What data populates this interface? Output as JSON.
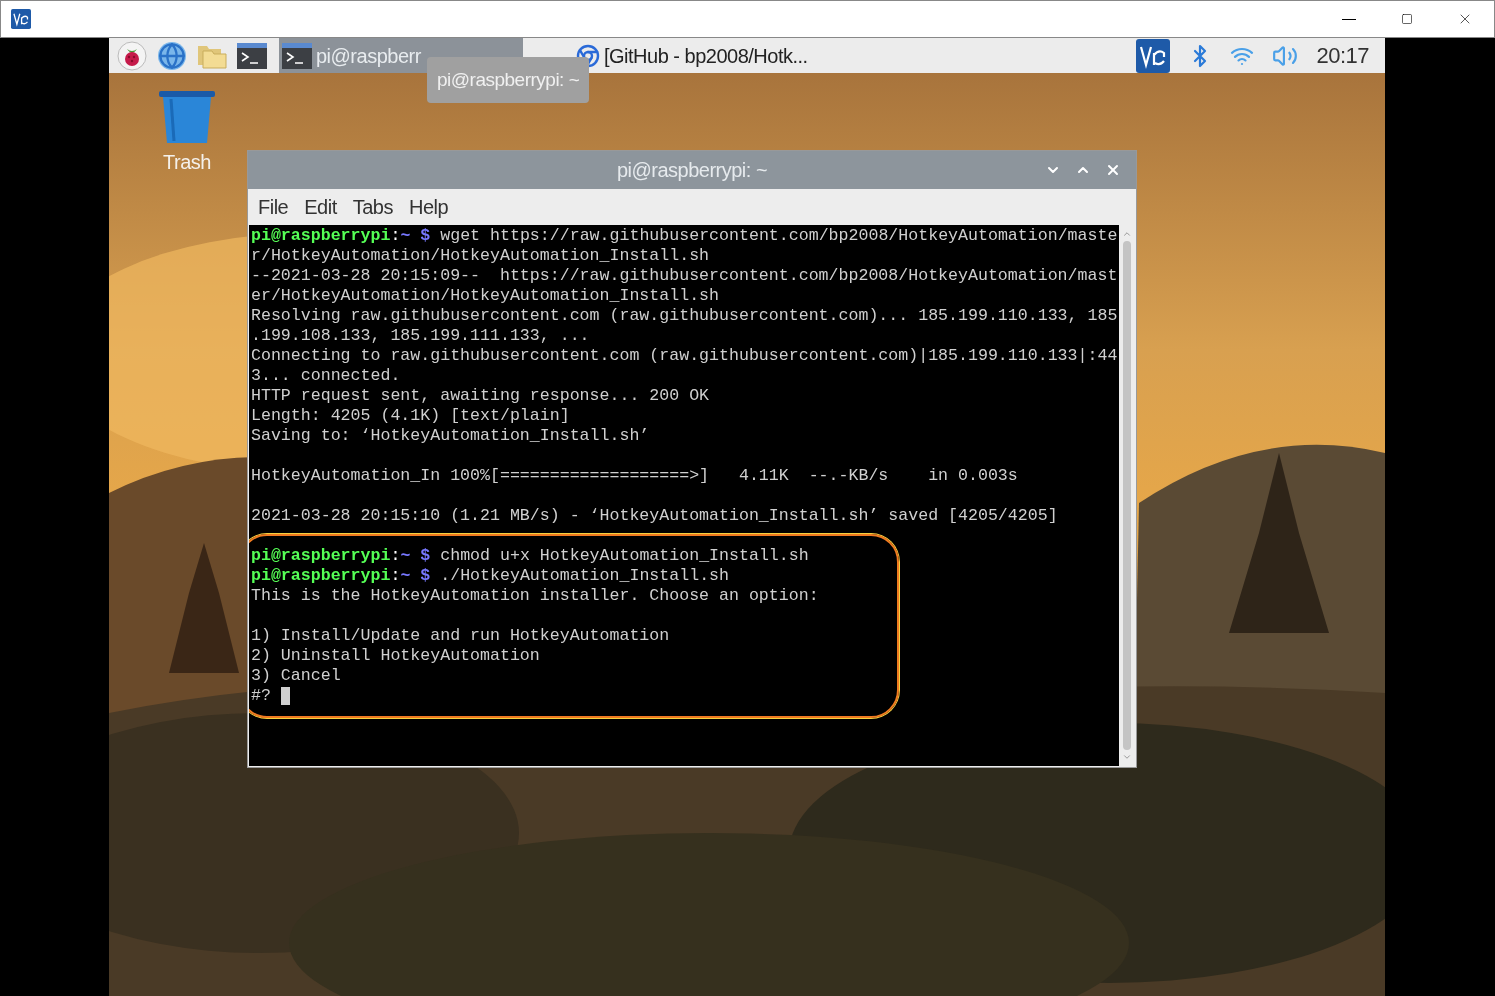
{
  "viewer_window": {
    "controls": [
      {
        "kind": "minimize"
      },
      {
        "kind": "maximize"
      },
      {
        "kind": "close"
      }
    ]
  },
  "taskbar": {
    "launchers": [
      {
        "kind": "menu"
      },
      {
        "kind": "browser"
      },
      {
        "kind": "files"
      },
      {
        "kind": "terminal"
      }
    ],
    "tasks": [
      {
        "kind": "terminal",
        "label": "pi@raspberr",
        "selected": true
      },
      {
        "kind": "browser",
        "label": "[GitHub - bp2008/Hotk...",
        "selected": false
      }
    ],
    "tray": [
      {
        "kind": "vnc"
      },
      {
        "kind": "bluetooth"
      },
      {
        "kind": "wifi"
      },
      {
        "kind": "volume"
      }
    ],
    "clock": "20:17"
  },
  "tooltip": "pi@raspberrypi: ~",
  "desktop_icons": [
    {
      "kind": "trash",
      "label": "Trash"
    }
  ],
  "terminal": {
    "title": "pi@raspberrypi: ~",
    "controls": [
      {
        "kind": "minimize"
      },
      {
        "kind": "maximize"
      },
      {
        "kind": "close"
      }
    ],
    "menu": [
      "File",
      "Edit",
      "Tabs",
      "Help"
    ],
    "blocks": [
      {
        "highlighted": false,
        "lines": [
          {
            "kind": "prompt",
            "user": "pi@raspberrypi",
            "sep": ":",
            "path": "~",
            "symbol": "$",
            "command": "wget https://raw.githubusercontent.com/bp2008/HotkeyAutomation/maste"
          },
          {
            "kind": "output",
            "text": "r/HotkeyAutomation/HotkeyAutomation_Install.sh"
          },
          {
            "kind": "output",
            "text": "--2021-03-28 20:15:09--  https://raw.githubusercontent.com/bp2008/HotkeyAutomation/mast"
          },
          {
            "kind": "output",
            "text": "er/HotkeyAutomation/HotkeyAutomation_Install.sh"
          },
          {
            "kind": "output",
            "text": "Resolving raw.githubusercontent.com (raw.githubusercontent.com)... 185.199.110.133, 185"
          },
          {
            "kind": "output",
            "text": ".199.108.133, 185.199.111.133, ..."
          },
          {
            "kind": "output",
            "text": "Connecting to raw.githubusercontent.com (raw.githubusercontent.com)|185.199.110.133|:44"
          },
          {
            "kind": "output",
            "text": "3... connected."
          },
          {
            "kind": "output",
            "text": "HTTP request sent, awaiting response... 200 OK"
          },
          {
            "kind": "output",
            "text": "Length: 4205 (4.1K) [text/plain]"
          },
          {
            "kind": "output",
            "text": "Saving to: ‘HotkeyAutomation_Install.sh’"
          },
          {
            "kind": "blank"
          },
          {
            "kind": "output",
            "text": "HotkeyAutomation_In 100%[===================>]   4.11K  --.-KB/s    in 0.003s"
          },
          {
            "kind": "blank"
          },
          {
            "kind": "output",
            "text": "2021-03-28 20:15:10 (1.21 MB/s) - ‘HotkeyAutomation_Install.sh’ saved [4205/4205]"
          },
          {
            "kind": "blank"
          }
        ]
      },
      {
        "highlighted": true,
        "lines": [
          {
            "kind": "prompt",
            "user": "pi@raspberrypi",
            "sep": ":",
            "path": "~",
            "symbol": "$",
            "command": "chmod u+x HotkeyAutomation_Install.sh"
          },
          {
            "kind": "prompt",
            "user": "pi@raspberrypi",
            "sep": ":",
            "path": "~",
            "symbol": "$",
            "command": "./HotkeyAutomation_Install.sh"
          },
          {
            "kind": "output",
            "text": "This is the HotkeyAutomation installer. Choose an option:"
          },
          {
            "kind": "blank"
          },
          {
            "kind": "output",
            "text": "1) Install/Update and run HotkeyAutomation"
          },
          {
            "kind": "output",
            "text": "2) Uninstall HotkeyAutomation"
          },
          {
            "kind": "output",
            "text": "3) Cancel"
          },
          {
            "kind": "input",
            "text": "#?"
          }
        ]
      }
    ]
  }
}
